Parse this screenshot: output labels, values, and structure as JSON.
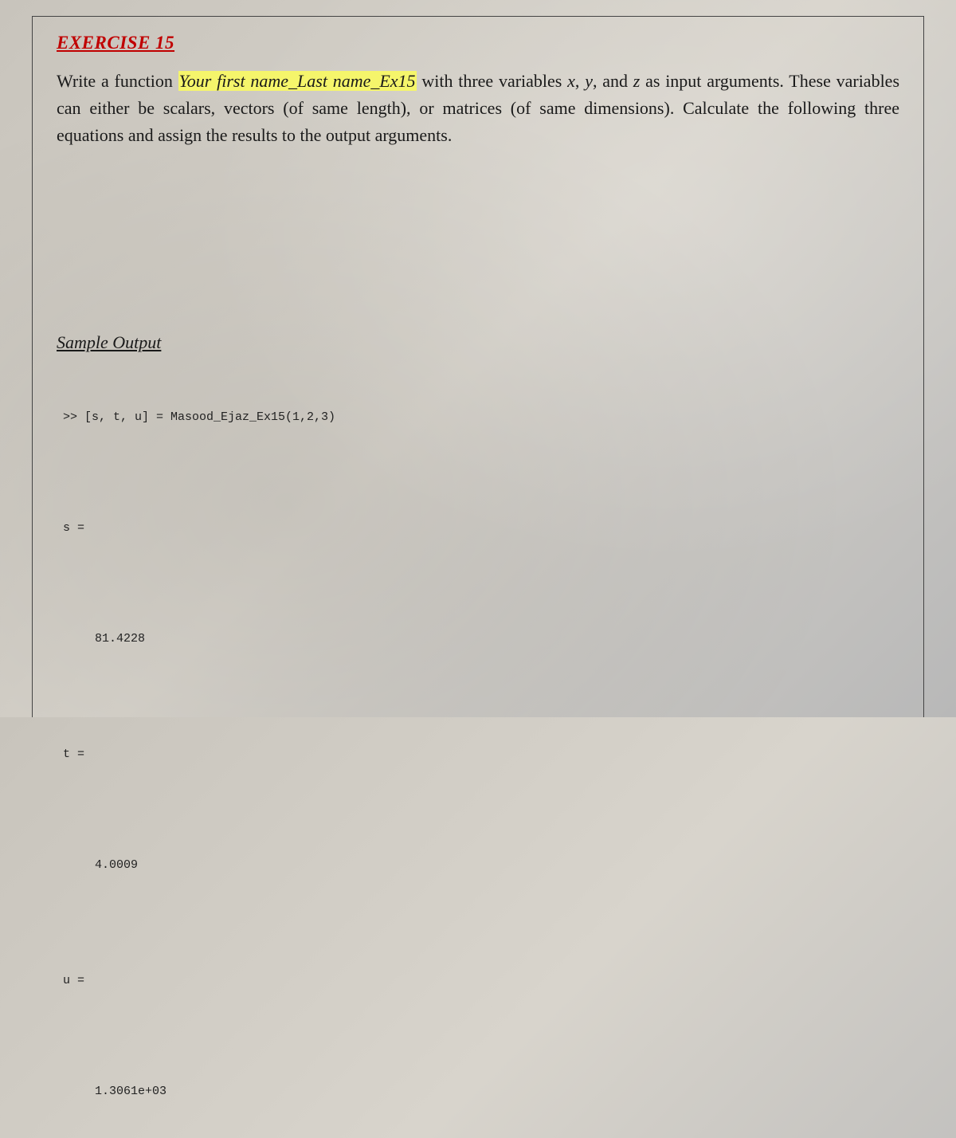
{
  "exercise": {
    "title": "EXERCISE 15",
    "prompt_pre": "Write a function ",
    "highlight": "Your first name_Last name_Ex15",
    "prompt_post1": " with three variables ",
    "var_x": "x",
    "comma1": ", ",
    "var_y": "y",
    "comma2": ", and ",
    "var_z": "z",
    "prompt_post2": " as input arguments. These variables can either be scalars, vectors (of same length), or matrices (of same dimensions). Calculate the following three equations and assign the results to the output arguments."
  },
  "sample": {
    "heading": "Sample Output",
    "cmd": ">> [s, t, u] = Masood_Ejaz_Ex15(1,2,3)",
    "s_label": "s =",
    "s_value": "81.4228",
    "t_label": "t =",
    "t_value": "4.0009",
    "u_label": "u =",
    "u_value": "1.3061e+03"
  }
}
